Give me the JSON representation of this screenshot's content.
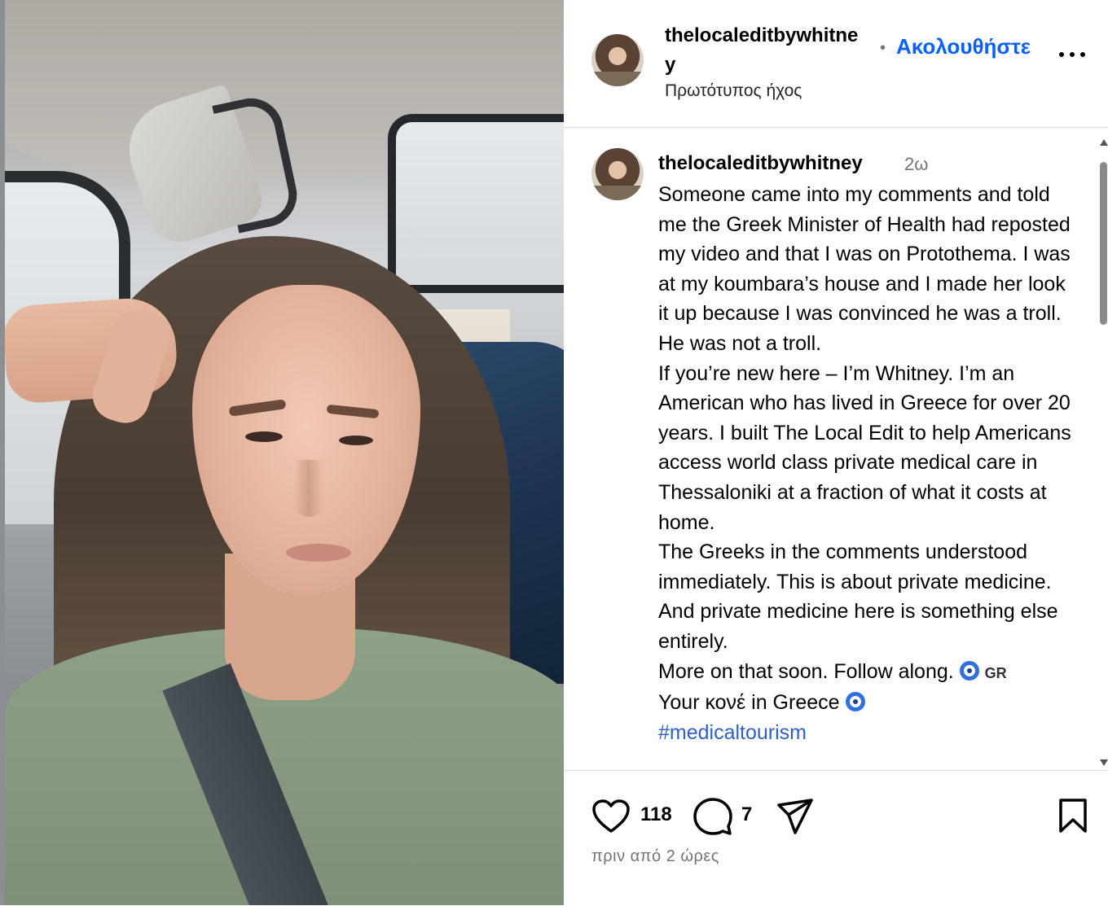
{
  "header": {
    "username": "thelocaleditbywhitney",
    "separator": "•",
    "follow_label": "Ακολουθήστε",
    "audio_label": "Πρωτότυπος ήχος",
    "more_icon": "more-horizontal-icon"
  },
  "caption": {
    "username": "thelocaleditbywhitney",
    "time": "2ω",
    "lines": [
      "Someone came into my comments and told me the Greek Minister of Health had reposted my video and that I was on Protothema. I was at my koumbara’s house and I made her look it up because I was convinced he was a troll.",
      "He was not a troll.",
      "If you’re new here – I’m Whitney. I’m an American who has lived in Greece for over 20 years. I built The Local Edit to help Americans access world class private medical care in Thessaloniki at a fraction of what it costs at home.",
      "The Greeks in the comments understood immediately. This is about private medicine. And private medicine here is something else entirely."
    ],
    "follow_line": "More on that soon. Follow along.",
    "flag_text": "GR",
    "tagline": "Your κονέ in Greece",
    "hashtag": "#medicaltourism"
  },
  "actions": {
    "likes": "118",
    "comments": "7",
    "time_ago": "πριν από 2 ώρες"
  },
  "colors": {
    "accent": "#0a5fff",
    "hashtag": "#2f5fc8",
    "muted": "#737373",
    "divider": "#dbdbdb"
  }
}
